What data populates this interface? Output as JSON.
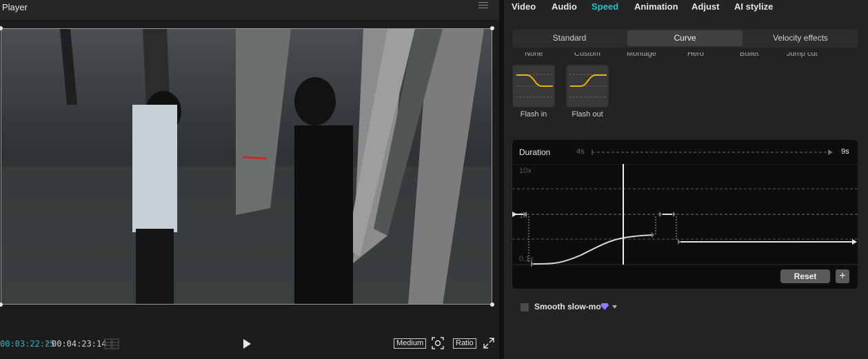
{
  "player": {
    "title": "Player",
    "current_time": "00:03:22:25",
    "separator": "/",
    "total_time": "00:04:23:14",
    "quality_label": "Medium",
    "ratio_label": "Ratio"
  },
  "tabs": [
    {
      "label": "Video",
      "active": false
    },
    {
      "label": "Audio",
      "active": false
    },
    {
      "label": "Speed",
      "active": true
    },
    {
      "label": "Animation",
      "active": false
    },
    {
      "label": "Adjust",
      "active": false
    },
    {
      "label": "AI stylize",
      "active": false
    }
  ],
  "speed_modes": [
    "Standard",
    "Curve",
    "Velocity effects"
  ],
  "active_speed_mode": "Curve",
  "presets_cut_off": [
    "None",
    "Custom",
    "Montage",
    "Hero",
    "Bullet",
    "Jump cut"
  ],
  "presets": [
    {
      "label": "Flash in",
      "icon": "flash-in-curve-icon"
    },
    {
      "label": "Flash out",
      "icon": "flash-out-curve-icon"
    }
  ],
  "curve_editor": {
    "duration_label": "Duration",
    "duration_min": "4s",
    "duration_max": "9s",
    "y_max_label": "10x",
    "y_mid_label": "1x",
    "y_min_label": "0.1x",
    "reset_label": "Reset",
    "add_label": "+"
  },
  "smooth_slowmo": {
    "label": "Smooth slow-mo",
    "checked": false,
    "icon": "gem-icon"
  },
  "colors": {
    "accent": "#23c0cf",
    "preset_curve": "#e8b400",
    "gem": "#8a7bff"
  }
}
